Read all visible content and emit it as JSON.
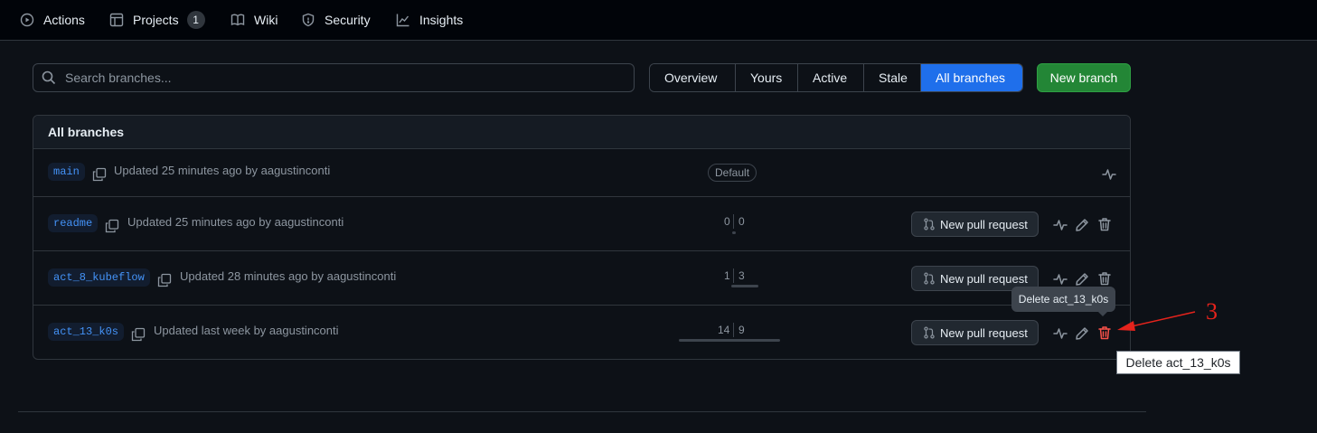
{
  "nav": {
    "actions": "Actions",
    "projects": "Projects",
    "projects_count": "1",
    "wiki": "Wiki",
    "security": "Security",
    "insights": "Insights"
  },
  "search": {
    "placeholder": "Search branches..."
  },
  "filters": {
    "overview": "Overview",
    "yours": "Yours",
    "active": "Active",
    "stale": "Stale",
    "all": "All branches",
    "selected": "All branches"
  },
  "new_branch_label": "New branch",
  "table": {
    "title": "All branches",
    "default_badge": "Default",
    "new_pr_label": "New pull request",
    "branches": [
      {
        "name": "main",
        "updated": "Updated 25 minutes ago by aagustinconti",
        "default": true
      },
      {
        "name": "readme",
        "updated": "Updated 25 minutes ago by aagustinconti",
        "behind": "0",
        "ahead": "0"
      },
      {
        "name": "act_8_kubeflow",
        "updated": "Updated 28 minutes ago by aagustinconti",
        "behind": "1",
        "ahead": "3"
      },
      {
        "name": "act_13_k0s",
        "updated": "Updated last week by aagustinconti",
        "behind": "14",
        "ahead": "9"
      }
    ]
  },
  "tooltip_text": "Delete act_13_k0s",
  "annotation": {
    "number": "3",
    "label": "Delete act_13_k0s"
  },
  "colors": {
    "accent": "#1f6feb",
    "primary_button": "#238636",
    "danger": "#f85149",
    "annotation": "#e5231c"
  },
  "icons": [
    "play-icon",
    "table-icon",
    "book-icon",
    "shield-icon",
    "graph-icon",
    "search-icon",
    "copy-icon",
    "git-pull-request-icon",
    "pulse-icon",
    "pencil-icon",
    "trash-icon"
  ]
}
